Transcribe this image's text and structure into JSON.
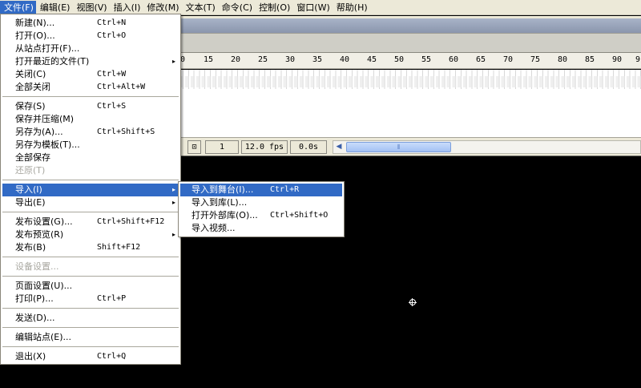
{
  "menubar": {
    "items": [
      "文件(F)",
      "编辑(E)",
      "视图(V)",
      "插入(I)",
      "修改(M)",
      "文本(T)",
      "命令(C)",
      "控制(O)",
      "窗口(W)",
      "帮助(H)"
    ]
  },
  "timeline": {
    "ruler_ticks": [
      "0",
      "15",
      "20",
      "25",
      "30",
      "35",
      "40",
      "45",
      "50",
      "55",
      "60",
      "65",
      "70",
      "75",
      "80",
      "85",
      "90",
      "9"
    ],
    "current_frame": "1",
    "frame_rate": "12.0 fps",
    "elapsed_time": "0.0s",
    "scroll_grip": "⦀"
  },
  "file_menu": {
    "items": [
      {
        "label": "新建(N)...",
        "shortcut": "Ctrl+N"
      },
      {
        "label": "打开(O)...",
        "shortcut": "Ctrl+O"
      },
      {
        "label": "从站点打开(F)...",
        "shortcut": ""
      },
      {
        "label": "打开最近的文件(T)",
        "shortcut": ""
      },
      {
        "label": "关闭(C)",
        "shortcut": "Ctrl+W"
      },
      {
        "label": "全部关闭",
        "shortcut": "Ctrl+Alt+W"
      },
      {
        "label": "保存(S)",
        "shortcut": "Ctrl+S"
      },
      {
        "label": "保存并压缩(M)",
        "shortcut": ""
      },
      {
        "label": "另存为(A)...",
        "shortcut": "Ctrl+Shift+S"
      },
      {
        "label": "另存为模板(T)...",
        "shortcut": ""
      },
      {
        "label": "全部保存",
        "shortcut": ""
      },
      {
        "label": "还原(T)",
        "shortcut": ""
      },
      {
        "label": "导入(I)",
        "shortcut": ""
      },
      {
        "label": "导出(E)",
        "shortcut": ""
      },
      {
        "label": "发布设置(G)...",
        "shortcut": "Ctrl+Shift+F12"
      },
      {
        "label": "发布预览(R)",
        "shortcut": ""
      },
      {
        "label": "发布(B)",
        "shortcut": "Shift+F12"
      },
      {
        "label": "设备设置...",
        "shortcut": ""
      },
      {
        "label": "页面设置(U)...",
        "shortcut": ""
      },
      {
        "label": "打印(P)...",
        "shortcut": "Ctrl+P"
      },
      {
        "label": "发送(D)...",
        "shortcut": ""
      },
      {
        "label": "编辑站点(E)...",
        "shortcut": ""
      },
      {
        "label": "退出(X)",
        "shortcut": "Ctrl+Q"
      }
    ]
  },
  "import_submenu": {
    "items": [
      {
        "label": "导入到舞台(I)...",
        "shortcut": "Ctrl+R"
      },
      {
        "label": "导入到库(L)...",
        "shortcut": ""
      },
      {
        "label": "打开外部库(O)...",
        "shortcut": "Ctrl+Shift+O"
      },
      {
        "label": "导入视频...",
        "shortcut": ""
      }
    ]
  },
  "icons": {
    "submenu_arrow": "▸",
    "scroll_left": "◀",
    "fit_icon": "⊡"
  },
  "colors": {
    "highlight": "#316ac5",
    "stage": "#000000",
    "menu_bg": "#ffffff",
    "chrome_bg": "#ece9d8"
  }
}
